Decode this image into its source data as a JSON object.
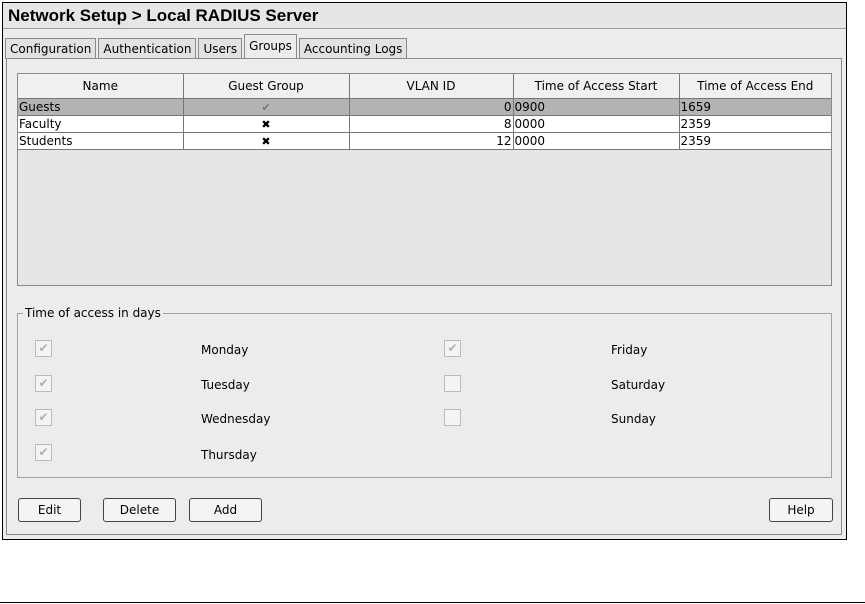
{
  "window": {
    "title": "Network Setup > Local RADIUS Server"
  },
  "tabs": [
    {
      "label": "Configuration",
      "active": false
    },
    {
      "label": "Authentication",
      "active": false
    },
    {
      "label": "Users",
      "active": false
    },
    {
      "label": "Groups",
      "active": true
    },
    {
      "label": "Accounting Logs",
      "active": false
    }
  ],
  "groups_table": {
    "columns": [
      "Name",
      "Guest Group",
      "VLAN ID",
      "Time of Access Start",
      "Time of Access End"
    ],
    "rows": [
      {
        "name": "Guests",
        "guest_group": "✔",
        "vlan_id": "0",
        "start": "0900",
        "end": "1659",
        "selected": true
      },
      {
        "name": "Faculty",
        "guest_group": "✖",
        "vlan_id": "8",
        "start": "0000",
        "end": "2359",
        "selected": false
      },
      {
        "name": "Students",
        "guest_group": "✖",
        "vlan_id": "12",
        "start": "0000",
        "end": "2359",
        "selected": false
      }
    ]
  },
  "access_days": {
    "legend": "Time of access in days",
    "days": [
      {
        "label": "Monday",
        "checked": true,
        "mark": "✔"
      },
      {
        "label": "Tuesday",
        "checked": true,
        "mark": "✔"
      },
      {
        "label": "Wednesday",
        "checked": true,
        "mark": "✔"
      },
      {
        "label": "Thursday",
        "checked": true,
        "mark": "✔"
      },
      {
        "label": "Friday",
        "checked": true,
        "mark": "✔"
      },
      {
        "label": "Saturday",
        "checked": false,
        "mark": ""
      },
      {
        "label": "Sunday",
        "checked": false,
        "mark": ""
      }
    ]
  },
  "buttons": {
    "edit": "Edit",
    "delete": "Delete",
    "add": "Add",
    "help": "Help"
  },
  "colors": {
    "selected_row": "#b3b3b3",
    "panel_bg": "#ececec"
  }
}
